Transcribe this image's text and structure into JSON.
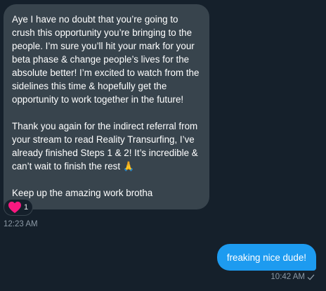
{
  "conversation": {
    "received": {
      "paragraphs": [
        "Aye I have no doubt that you’re going to crush this opportunity you’re bringing to the people. I’m sure you’ll hit your mark for your beta phase & change people’s lives for the absolute better! I’m excited to watch from the sidelines this time & hopefully get the opportunity to work together in the future!",
        "Thank you again for the indirect referral from your stream to read Reality Transurfing, I’ve already finished Steps 1 & 2! It’s incredible & can’t wait to finish the rest 🙏",
        "Keep up the amazing work brotha"
      ],
      "reaction": {
        "icon": "heart-icon",
        "count": "1"
      },
      "timestamp": "12:23 AM"
    },
    "sent": {
      "text": "freaking nice dude!",
      "timestamp": "10:42 AM",
      "status_icon": "check-icon"
    }
  },
  "colors": {
    "background": "#15202b",
    "received_bubble": "#38444d",
    "sent_bubble": "#1d9bf0",
    "timestamp": "#8b98a5",
    "heart": "#f91880"
  }
}
